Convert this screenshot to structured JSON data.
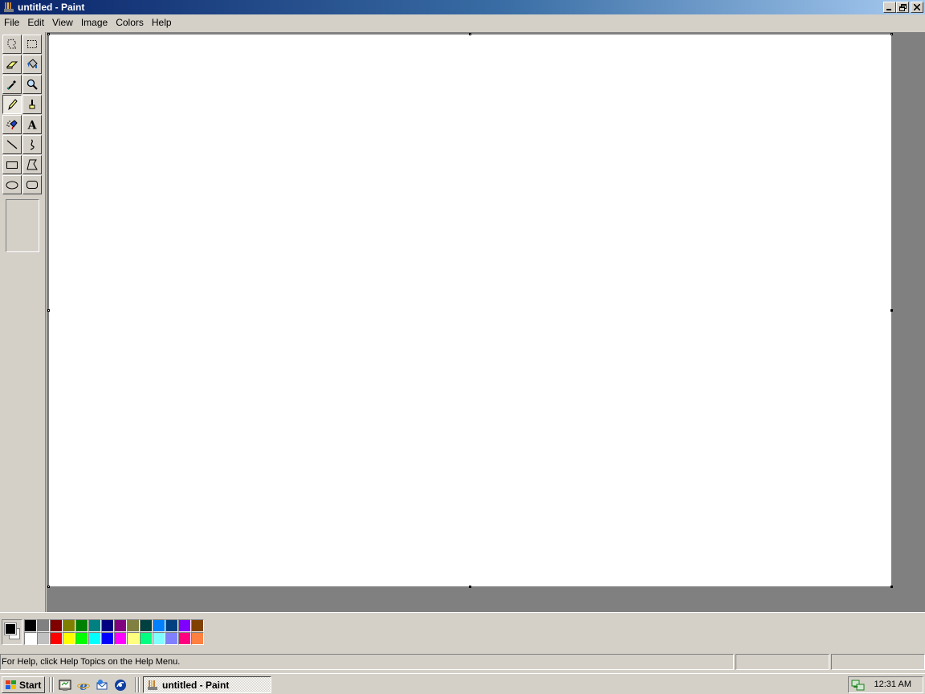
{
  "window": {
    "title": "untitled - Paint",
    "buttons": [
      "minimize",
      "restore",
      "close"
    ]
  },
  "menubar": {
    "items": [
      "File",
      "Edit",
      "View",
      "Image",
      "Colors",
      "Help"
    ]
  },
  "toolbox": {
    "tools": [
      {
        "name": "free-form-select",
        "icon": "free-select-icon"
      },
      {
        "name": "select",
        "icon": "rect-select-icon"
      },
      {
        "name": "eraser",
        "icon": "eraser-icon"
      },
      {
        "name": "fill-with-color",
        "icon": "paint-bucket-icon"
      },
      {
        "name": "pick-color",
        "icon": "eyedropper-icon"
      },
      {
        "name": "magnifier",
        "icon": "magnifier-icon"
      },
      {
        "name": "pencil",
        "icon": "pencil-icon",
        "active": true
      },
      {
        "name": "brush",
        "icon": "brush-icon"
      },
      {
        "name": "airbrush",
        "icon": "airbrush-icon"
      },
      {
        "name": "text",
        "icon": "text-icon",
        "glyph": "A"
      },
      {
        "name": "line",
        "icon": "line-icon"
      },
      {
        "name": "curve",
        "icon": "curve-icon"
      },
      {
        "name": "rectangle",
        "icon": "rectangle-icon"
      },
      {
        "name": "polygon",
        "icon": "polygon-icon"
      },
      {
        "name": "ellipse",
        "icon": "ellipse-icon"
      },
      {
        "name": "rounded-rectangle",
        "icon": "rounded-rect-icon"
      }
    ]
  },
  "colors": {
    "foreground": "#000000",
    "background": "#ffffff",
    "palette_top": [
      "#000000",
      "#808080",
      "#800000",
      "#808000",
      "#008000",
      "#008080",
      "#000080",
      "#800080",
      "#808040",
      "#004040",
      "#0080ff",
      "#004080",
      "#8000ff",
      "#804000"
    ],
    "palette_bottom": [
      "#ffffff",
      "#c0c0c0",
      "#ff0000",
      "#ffff00",
      "#00ff00",
      "#00ffff",
      "#0000ff",
      "#ff00ff",
      "#ffff80",
      "#00ff80",
      "#80ffff",
      "#8080ff",
      "#ff0080",
      "#ff8040"
    ]
  },
  "statusbar": {
    "help_text": "For Help, click Help Topics on the Help Menu.",
    "coords": "",
    "size": ""
  },
  "taskbar": {
    "start_label": "Start",
    "quick_launch": [
      "show-desktop-icon",
      "internet-explorer-icon",
      "outlook-express-icon",
      "media-player-icon"
    ],
    "task_label": "untitled - Paint",
    "clock": "12:31 AM",
    "tray_icon": "network-icon"
  }
}
